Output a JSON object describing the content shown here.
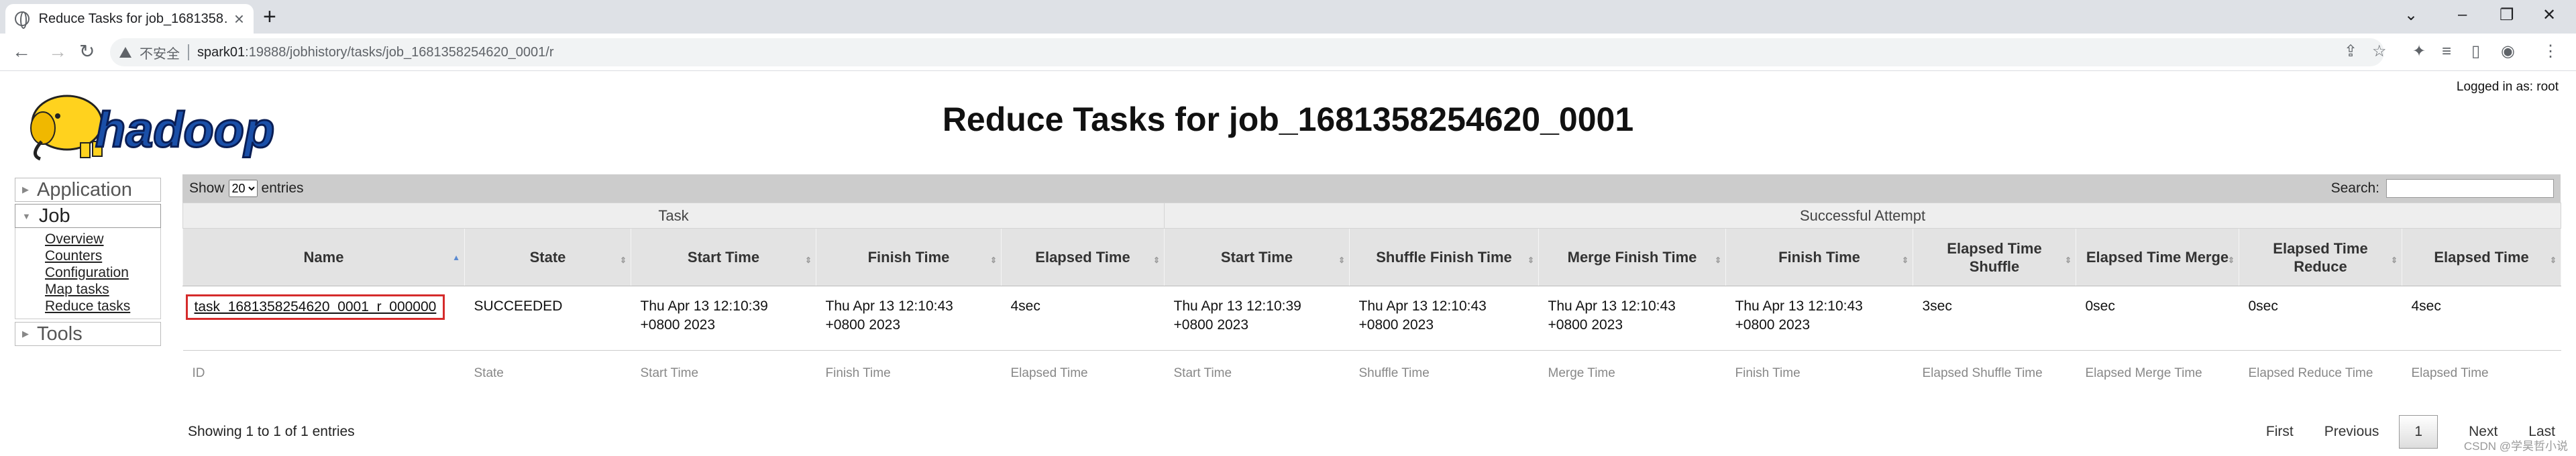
{
  "browser": {
    "tab_title": "Reduce Tasks for job_1681358…",
    "tab_close": "×",
    "new_tab": "+",
    "insecure_label": "不安全",
    "url_host": "spark01",
    "url_path": ":19888/jobhistory/tasks/job_1681358254620_0001/r"
  },
  "header": {
    "logged_in": "Logged in as: root",
    "logo_text": "hadoop",
    "page_title": "Reduce Tasks for job_1681358254620_0001"
  },
  "sidebar": {
    "application": "Application",
    "job": "Job",
    "job_links": [
      "Overview",
      "Counters",
      "Configuration",
      "Map tasks",
      "Reduce tasks"
    ],
    "tools": "Tools"
  },
  "table": {
    "show_label": "Show",
    "page_size": "20",
    "entries_label": "entries",
    "search_label": "Search:",
    "group_task": "Task",
    "group_attempt": "Successful Attempt",
    "columns": [
      "Name",
      "State",
      "Start Time",
      "Finish Time",
      "Elapsed Time",
      "Start Time",
      "Shuffle Finish Time",
      "Merge Finish Time",
      "Finish Time",
      "Elapsed Time Shuffle",
      "Elapsed Time Merge",
      "Elapsed Time Reduce",
      "Elapsed Time"
    ],
    "row": {
      "name": "task_1681358254620_0001_r_000000",
      "state": "SUCCEEDED",
      "start": "Thu Apr 13 12:10:39 +0800 2023",
      "finish": "Thu Apr 13 12:10:43 +0800 2023",
      "elapsed": "4sec",
      "a_start": "Thu Apr 13 12:10:39 +0800 2023",
      "a_shuffle": "Thu Apr 13 12:10:43 +0800 2023",
      "a_merge": "Thu Apr 13 12:10:43 +0800 2023",
      "a_finish": "Thu Apr 13 12:10:43 +0800 2023",
      "e_shuffle": "3sec",
      "e_merge": "0sec",
      "e_reduce": "0sec",
      "e_total": "4sec"
    },
    "footer": [
      "ID",
      "State",
      "Start Time",
      "Finish Time",
      "Elapsed Time",
      "Start Time",
      "Shuffle Time",
      "Merge Time",
      "Finish Time",
      "Elapsed Shuffle Time",
      "Elapsed Merge Time",
      "Elapsed Reduce Time",
      "Elapsed Time"
    ],
    "info": "Showing 1 to 1 of 1 entries",
    "first": "First",
    "previous": "Previous",
    "current_page": "1",
    "next": "Next",
    "last": "Last"
  },
  "watermark": "CSDN @学昊哲小说"
}
